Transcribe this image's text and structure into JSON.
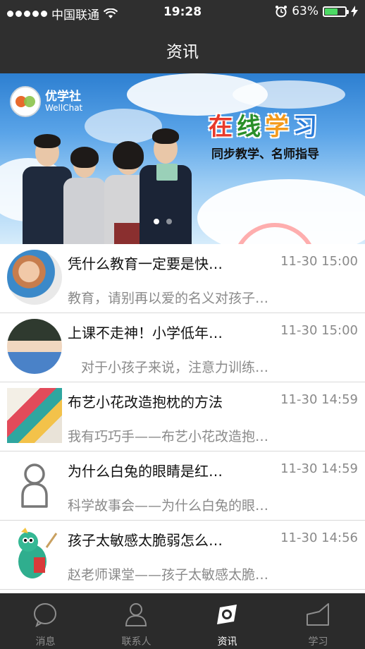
{
  "status_bar": {
    "carrier": "中国联通",
    "time": "19:28",
    "battery": "63%",
    "battery_level": 0.63
  },
  "nav": {
    "title": "资讯"
  },
  "banner": {
    "logo_name": "优学社",
    "logo_sub": "WellChat",
    "headline_chars": [
      "在",
      "线",
      "学",
      "习"
    ],
    "subtitle": "同步教学、名师指导",
    "pager_total": 2,
    "pager_active": 1
  },
  "news": [
    {
      "title": "凭什么教育一定要是快…",
      "time": "11-30 15:00",
      "desc": "教育，请别再以爱的名义对孩子…",
      "icon": "teacher-child-photo"
    },
    {
      "title": "上课不走神！小学低年…",
      "time": "11-30 15:00",
      "desc": "　对于小孩子来说，注意力训练…",
      "icon": "classroom-photo"
    },
    {
      "title": "布艺小花改造抱枕的方法",
      "time": "11-30 14:59",
      "desc": "我有巧巧手——布艺小花改造抱…",
      "icon": "fabric-photo"
    },
    {
      "title": "为什么白兔的眼睛是红…",
      "time": "11-30 14:59",
      "desc": "科学故事会——为什么白兔的眼…",
      "icon": "person-placeholder-icon"
    },
    {
      "title": "孩子太敏感太脆弱怎么…",
      "time": "11-30 14:56",
      "desc": "赵老师课堂——孩子太敏感太脆…",
      "icon": "dragon-cartoon"
    }
  ],
  "tabs": [
    {
      "label": "消息",
      "icon": "chat-bubble-icon",
      "active": false
    },
    {
      "label": "联系人",
      "icon": "contact-person-icon",
      "active": false
    },
    {
      "label": "资讯",
      "icon": "compass-eye-icon",
      "active": true
    },
    {
      "label": "学习",
      "icon": "chart-area-icon",
      "active": false
    }
  ]
}
